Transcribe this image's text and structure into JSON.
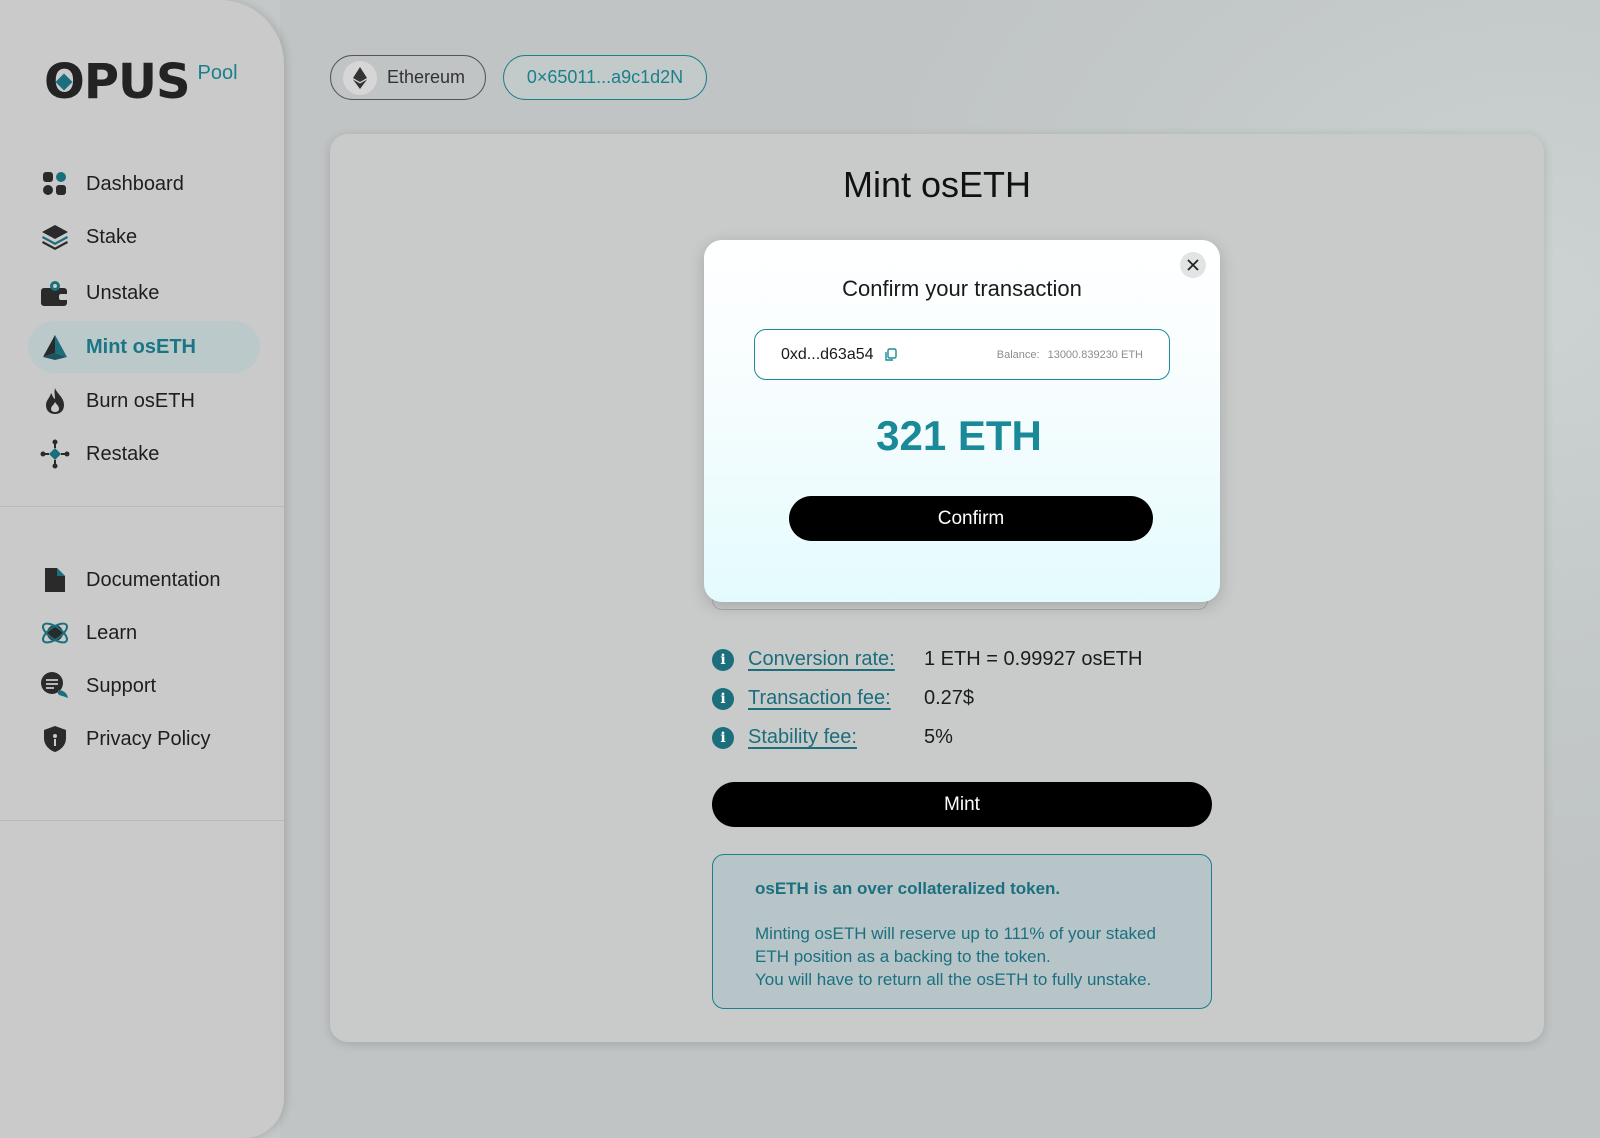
{
  "brand": {
    "name_prefix": "O",
    "name_rest": "PUS",
    "suffix": "Pool",
    "accent": "#1b7f8c"
  },
  "sidebar": {
    "main_items": [
      {
        "label": "Dashboard",
        "icon": "dashboard-icon"
      },
      {
        "label": "Stake",
        "icon": "layers-icon"
      },
      {
        "label": "Unstake",
        "icon": "wallet-icon"
      },
      {
        "label": "Mint osETH",
        "icon": "pyramid-icon",
        "active": true
      },
      {
        "label": "Burn osETH",
        "icon": "flame-icon"
      },
      {
        "label": "Restake",
        "icon": "network-icon"
      }
    ],
    "secondary_items": [
      {
        "label": "Documentation",
        "icon": "document-icon"
      },
      {
        "label": "Learn",
        "icon": "atom-icon"
      },
      {
        "label": "Support",
        "icon": "chat-icon"
      },
      {
        "label": "Privacy Policy",
        "icon": "shield-icon"
      }
    ]
  },
  "topbar": {
    "network": "Ethereum",
    "wallet": "0×65011...a9c1d2N"
  },
  "page": {
    "title": "Mint osETH"
  },
  "info": [
    {
      "label": "Conversion rate:",
      "value": "1 ETH = 0.99927 osETH"
    },
    {
      "label": "Transaction fee:",
      "value": "0.27$"
    },
    {
      "label": "Stability fee:",
      "value": "5%"
    }
  ],
  "mint_button": "Mint",
  "notice": {
    "heading": "osETH is an over collateralized token.",
    "line1": "Minting osETH will reserve up to 111% of your staked ETH position as a backing to the token.",
    "line2": "You will have to return all the osETH to fully unstake."
  },
  "modal": {
    "title": "Confirm your transaction",
    "address": "0xd...d63a54",
    "balance_label": "Balance:",
    "balance_value": "13000.839230 ETH",
    "amount": "321 ETH",
    "confirm": "Confirm"
  }
}
